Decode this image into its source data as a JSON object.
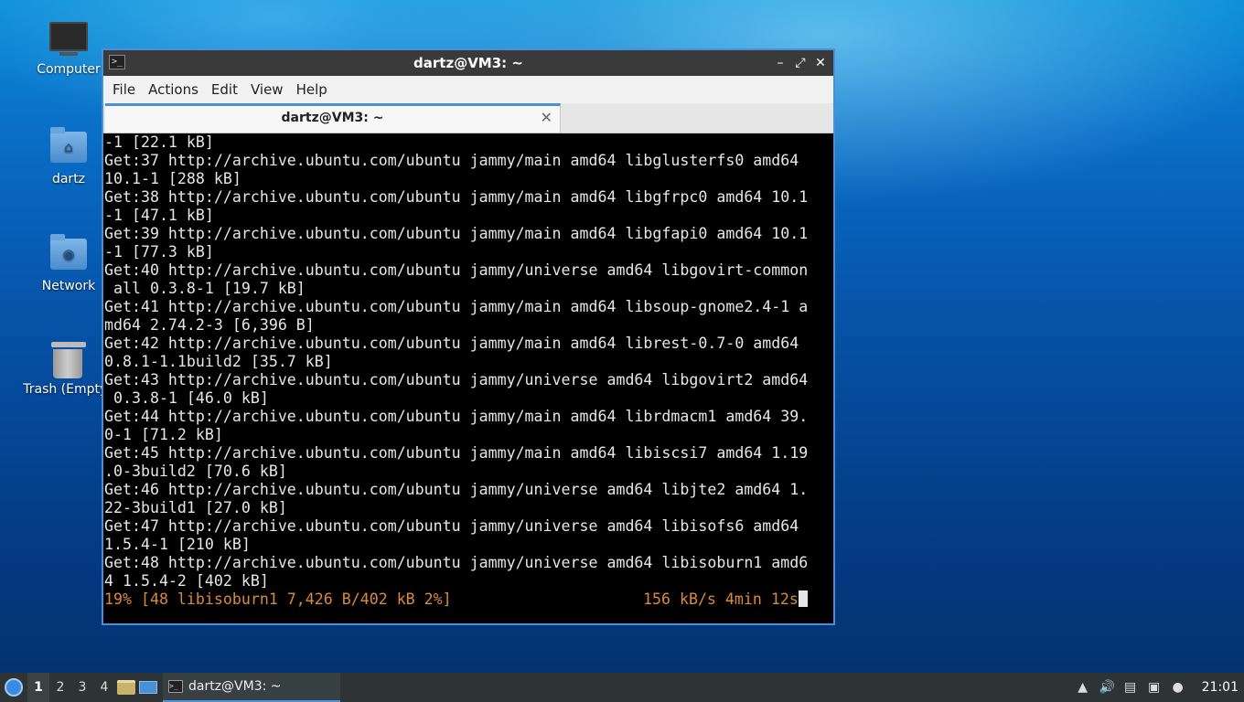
{
  "desktop": {
    "icons": [
      {
        "label": "Computer",
        "icon": "computer-icon"
      },
      {
        "label": "dartz",
        "icon": "home-folder-icon"
      },
      {
        "label": "Network",
        "icon": "network-folder-icon"
      },
      {
        "label": "Trash (Empty)",
        "icon": "trash-icon"
      }
    ]
  },
  "window": {
    "title": "dartz@VM3: ~",
    "menu": [
      "File",
      "Actions",
      "Edit",
      "View",
      "Help"
    ],
    "tab_title": "dartz@VM3: ~",
    "buttons": {
      "minimize": "–",
      "maximize": "⤢",
      "close": "✕"
    }
  },
  "terminal": {
    "lines": [
      "-1 [22.1 kB]",
      "Get:37 http://archive.ubuntu.com/ubuntu jammy/main amd64 libglusterfs0 amd64",
      "10.1-1 [288 kB]",
      "Get:38 http://archive.ubuntu.com/ubuntu jammy/main amd64 libgfrpc0 amd64 10.1",
      "-1 [47.1 kB]",
      "Get:39 http://archive.ubuntu.com/ubuntu jammy/main amd64 libgfapi0 amd64 10.1",
      "-1 [77.3 kB]",
      "Get:40 http://archive.ubuntu.com/ubuntu jammy/universe amd64 libgovirt-common",
      " all 0.3.8-1 [19.7 kB]",
      "Get:41 http://archive.ubuntu.com/ubuntu jammy/main amd64 libsoup-gnome2.4-1 a",
      "md64 2.74.2-3 [6,396 B]",
      "Get:42 http://archive.ubuntu.com/ubuntu jammy/main amd64 librest-0.7-0 amd64",
      "0.8.1-1.1build2 [35.7 kB]",
      "Get:43 http://archive.ubuntu.com/ubuntu jammy/universe amd64 libgovirt2 amd64",
      " 0.3.8-1 [46.0 kB]",
      "Get:44 http://archive.ubuntu.com/ubuntu jammy/main amd64 librdmacm1 amd64 39.",
      "0-1 [71.2 kB]",
      "Get:45 http://archive.ubuntu.com/ubuntu jammy/main amd64 libiscsi7 amd64 1.19",
      ".0-3build2 [70.6 kB]",
      "Get:46 http://archive.ubuntu.com/ubuntu jammy/universe amd64 libjte2 amd64 1.",
      "22-3build1 [27.0 kB]",
      "Get:47 http://archive.ubuntu.com/ubuntu jammy/universe amd64 libisofs6 amd64",
      "1.5.4-1 [210 kB]",
      "Get:48 http://archive.ubuntu.com/ubuntu jammy/universe amd64 libisoburn1 amd6",
      "4 1.5.4-2 [402 kB]"
    ],
    "status_left": "19% [48 libisoburn1 7,426 B/402 kB 2%]",
    "status_right": "156 kB/s 4min 12s",
    "colors": {
      "background": "#000000",
      "text": "#e6e6e6",
      "status": "#d98a3a"
    }
  },
  "taskbar": {
    "workspaces": [
      "1",
      "2",
      "3",
      "4"
    ],
    "active_workspace": "1",
    "task_label": "dartz@VM3: ~",
    "clock": "21:01",
    "tray_icons": [
      "scroll-up-icon",
      "volume-icon",
      "clipboard-icon",
      "network-icon",
      "updates-icon"
    ]
  }
}
